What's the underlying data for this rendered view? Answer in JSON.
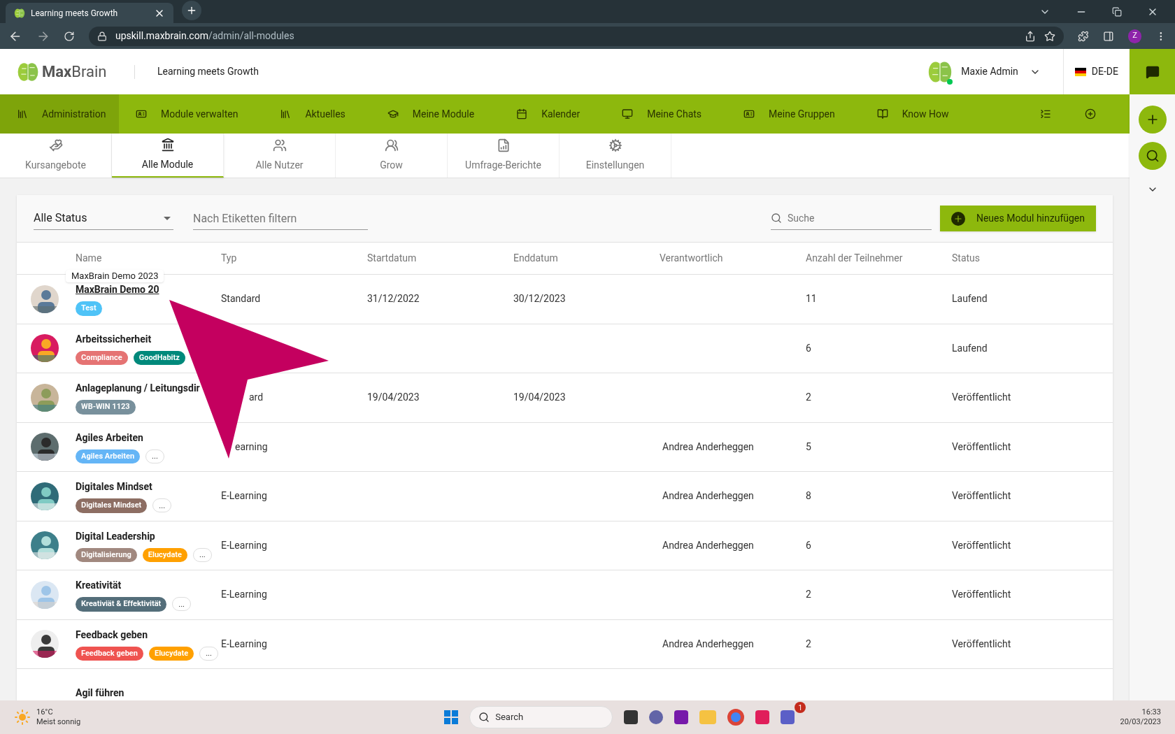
{
  "browser": {
    "tab_title": "Learning meets Growth",
    "url_host": "upskill.maxbrain.com",
    "url_path": "/admin/all-modules",
    "profile_initial": "Z"
  },
  "header": {
    "brand_bold": "Max",
    "brand_light": "Brain",
    "tagline": "Learning meets Growth",
    "user_name": "Maxie Admin",
    "online": true,
    "language": "DE-DE"
  },
  "nav": [
    {
      "label": "Administration",
      "selected": true
    },
    {
      "label": "Module verwalten",
      "selected": false
    },
    {
      "label": "Aktuelles",
      "selected": false
    },
    {
      "label": "Meine Module",
      "selected": false
    },
    {
      "label": "Kalender",
      "selected": false
    },
    {
      "label": "Meine Chats",
      "selected": false
    },
    {
      "label": "Meine Gruppen",
      "selected": false
    },
    {
      "label": "Know How",
      "selected": false
    }
  ],
  "subtabs": [
    {
      "label": "Kursangebote",
      "selected": false
    },
    {
      "label": "Alle Module",
      "selected": true
    },
    {
      "label": "Alle Nutzer",
      "selected": false
    },
    {
      "label": "Grow",
      "selected": false
    },
    {
      "label": "Umfrage-Berichte",
      "selected": false
    },
    {
      "label": "Einstellungen",
      "selected": false
    }
  ],
  "filters": {
    "status": "Alle Status",
    "tags_placeholder": "Nach Etiketten filtern",
    "search_placeholder": "Suche",
    "add_button": "Neues Modul hinzufügen"
  },
  "table": {
    "columns": [
      "Name",
      "Typ",
      "Startdatum",
      "Enddatum",
      "Verantwortlich",
      "Anzahl der Teilnehmer",
      "Status"
    ],
    "rows": [
      {
        "name": "MaxBrain Demo 20",
        "hovered": true,
        "tags": [
          {
            "label": "Test",
            "color": "#4fc3f7"
          }
        ],
        "more": false,
        "typ": "Standard",
        "start": "31/12/2022",
        "end": "30/12/2023",
        "owner": "",
        "count": "11",
        "status": "Laufend"
      },
      {
        "name": "Arbeitssicherheit",
        "hovered": false,
        "tags": [
          {
            "label": "Compliance",
            "color": "#e57373"
          },
          {
            "label": "GoodHabitz",
            "color": "#00897b"
          }
        ],
        "more": false,
        "typ": "",
        "start": "",
        "end": "",
        "owner": "",
        "count": "6",
        "status": "Laufend"
      },
      {
        "name": "Anlageplanung / Leitungsdir",
        "hovered": false,
        "tags": [
          {
            "label": "WB-WIN 1123",
            "color": "#78909c"
          }
        ],
        "more": false,
        "typ": "ard",
        "start": "19/04/2023",
        "end": "19/04/2023",
        "owner": "",
        "count": "2",
        "status": "Veröffentlicht"
      },
      {
        "name": "Agiles Arbeiten",
        "hovered": false,
        "tags": [
          {
            "label": "Agiles Arbeiten",
            "color": "#64b5f6"
          }
        ],
        "more": true,
        "typ": "earning",
        "start": "",
        "end": "",
        "owner": "Andrea Anderheggen",
        "count": "5",
        "status": "Veröffentlicht"
      },
      {
        "name": "Digitales Mindset",
        "hovered": false,
        "tags": [
          {
            "label": "Digitales Mindset",
            "color": "#8d6e63"
          }
        ],
        "more": true,
        "typ": "E-Learning",
        "start": "",
        "end": "",
        "owner": "Andrea Anderheggen",
        "count": "8",
        "status": "Veröffentlicht"
      },
      {
        "name": "Digital Leadership",
        "hovered": false,
        "tags": [
          {
            "label": "Digitalisierung",
            "color": "#a1887f"
          },
          {
            "label": "Elucydate",
            "color": "#ffa000"
          }
        ],
        "more": true,
        "typ": "E-Learning",
        "start": "",
        "end": "",
        "owner": "Andrea Anderheggen",
        "count": "6",
        "status": "Veröffentlicht"
      },
      {
        "name": "Kreativität",
        "hovered": false,
        "tags": [
          {
            "label": "Kreativiät & Effektivität",
            "color": "#546e7a"
          }
        ],
        "more": true,
        "typ": "E-Learning",
        "start": "",
        "end": "",
        "owner": "",
        "count": "2",
        "status": "Veröffentlicht"
      },
      {
        "name": "Feedback geben",
        "hovered": false,
        "tags": [
          {
            "label": "Feedback geben",
            "color": "#ef5350"
          },
          {
            "label": "Elucydate",
            "color": "#ffa000"
          }
        ],
        "more": true,
        "typ": "E-Learning",
        "start": "",
        "end": "",
        "owner": "Andrea Anderheggen",
        "count": "2",
        "status": "Veröffentlicht"
      },
      {
        "name": "Agil führen",
        "hovered": false,
        "tags": [],
        "more": false,
        "typ": "",
        "start": "",
        "end": "",
        "owner": "",
        "count": "",
        "status": ""
      }
    ]
  },
  "more_label": "...",
  "tooltip": "MaxBrain Demo 2023",
  "annotation": {
    "kind": "arrow",
    "color": "#c4005f"
  },
  "taskbar": {
    "temperature": "16°C",
    "weather": "Meist sonnig",
    "search": "Search",
    "teams_badge": "1",
    "time": "16:33",
    "date": "20/03/2023"
  }
}
